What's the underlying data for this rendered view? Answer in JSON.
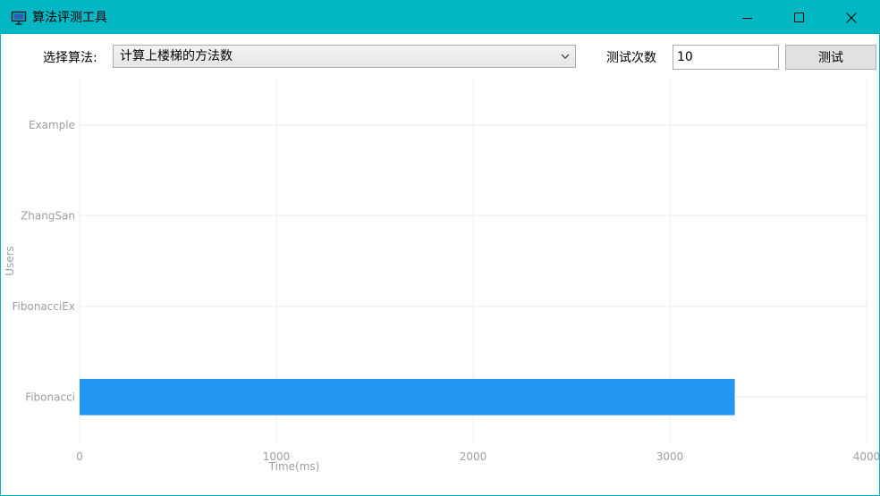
{
  "window": {
    "title": "算法评测工具",
    "border_color": "#00b5c2",
    "titlebar_color": "#00b7c3",
    "icons": {
      "app": "presentation-board-icon",
      "minimize": "minimize-icon",
      "maximize": "maximize-icon",
      "close": "close-icon"
    }
  },
  "toolbar": {
    "algorithm_label": "选择算法:",
    "algorithm_selected": "计算上楼梯的方法数",
    "count_label": "测试次数",
    "count_value": "10",
    "test_button": "测试"
  },
  "chart_data": {
    "type": "bar",
    "orientation": "horizontal",
    "categories": [
      "Example",
      "ZhangSan",
      "FibonacciEx",
      "Fibonacci"
    ],
    "values": [
      0,
      0,
      0,
      3330
    ],
    "xlabel": "Time(ms)",
    "ylabel": "Users",
    "xlim": [
      0,
      4000
    ],
    "xticks": [
      0,
      1000,
      2000,
      3000,
      4000
    ],
    "grid": true,
    "bar_color": "#2196f3",
    "grid_color": "#ececec",
    "label_color": "#9e9e9e"
  }
}
